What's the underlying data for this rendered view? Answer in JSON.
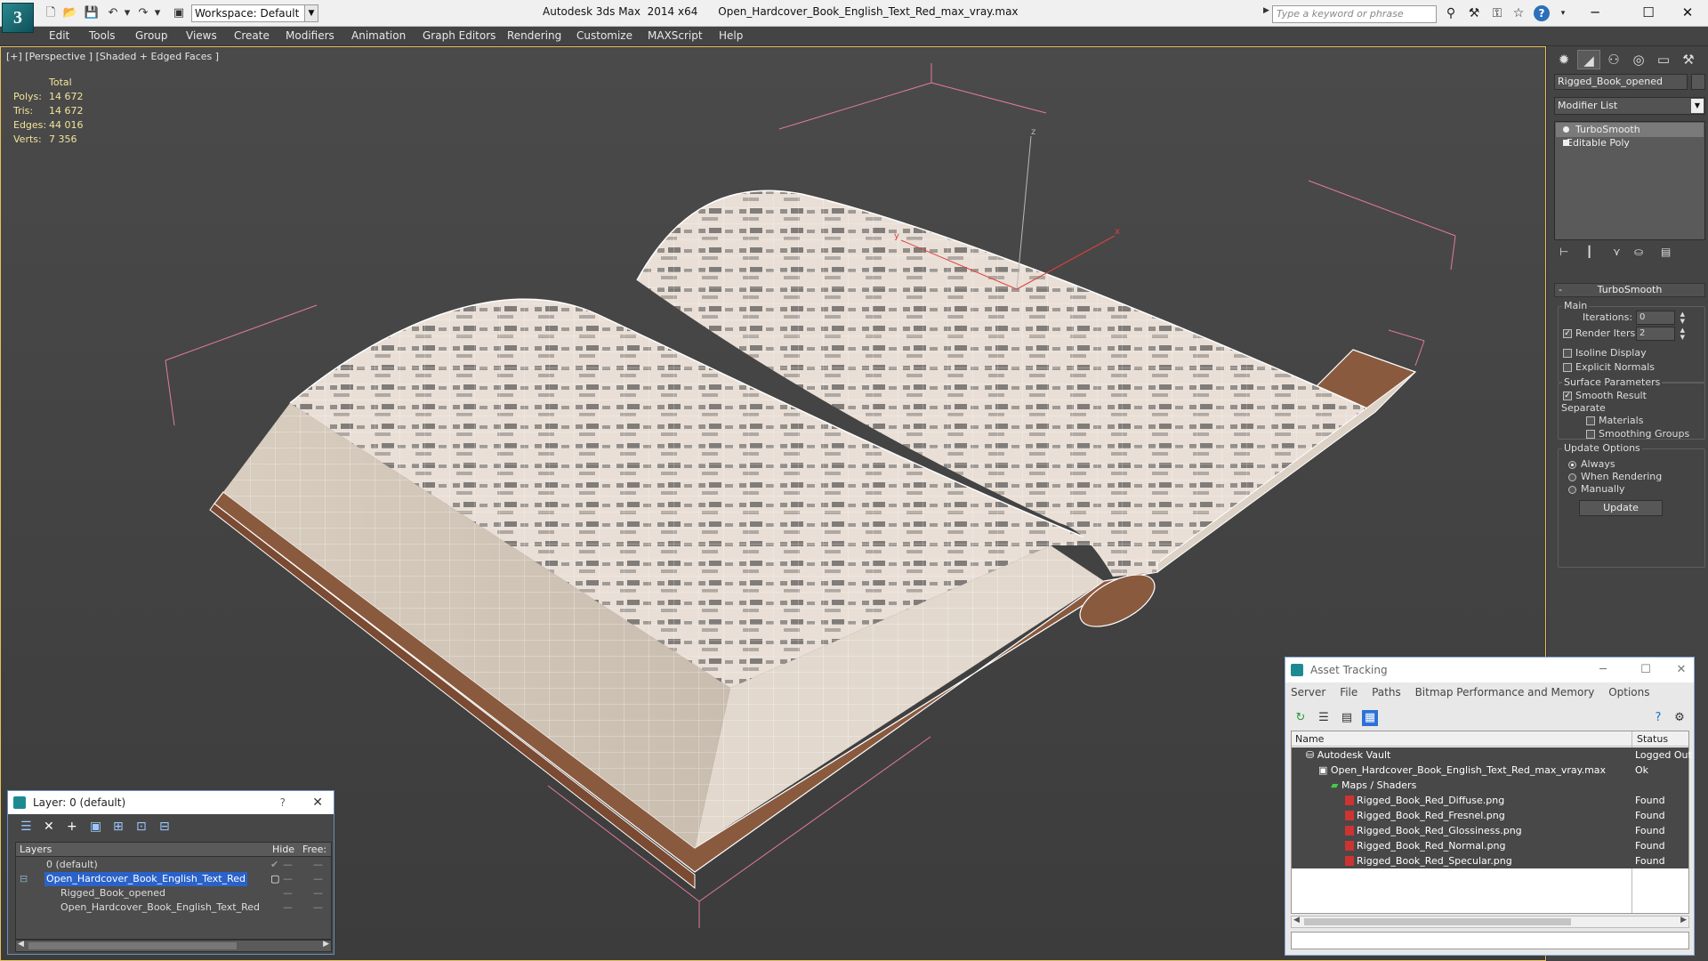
{
  "titlebar": {
    "app_logo": "3",
    "workspace": "Workspace: Default",
    "app_title": "Autodesk 3ds Max  2014 x64",
    "file_name": "Open_Hardcover_Book_English_Text_Red_max_vray.max",
    "search_placeholder": "Type a keyword or phrase",
    "help": "?"
  },
  "menu": {
    "items": [
      "Edit",
      "Tools",
      "Group",
      "Views",
      "Create",
      "Modifiers",
      "Animation",
      "Graph Editors",
      "Rendering",
      "Customize",
      "MAXScript",
      "Help"
    ]
  },
  "viewport": {
    "label": "[+] [Perspective ] [Shaded + Edged Faces ]",
    "stats": {
      "header": "Total",
      "polys_label": "Polys:",
      "polys": "14 672",
      "tris_label": "Tris:",
      "tris": "14 672",
      "edges_label": "Edges:",
      "edges": "44 016",
      "verts_label": "Verts:",
      "verts": "7 356"
    },
    "gizmo_z": "z",
    "gizmo_x": "x",
    "gizmo_y": "y"
  },
  "command_panel": {
    "object_name": "Rigged_Book_opened",
    "modifier_list": "Modifier List",
    "stack": [
      "TurboSmooth",
      "Editable Poly"
    ],
    "rollout_title": "TurboSmooth",
    "main_group": "Main",
    "iterations_label": "Iterations:",
    "iterations": "0",
    "render_iters_label": "Render Iters:",
    "render_iters": "2",
    "isoline_label": "Isoline Display",
    "explicit_normals_label": "Explicit Normals",
    "surface_group": "Surface Parameters",
    "smooth_result_label": "Smooth Result",
    "separate_label": "Separate",
    "materials_label": "Materials",
    "smoothing_groups_label": "Smoothing Groups",
    "update_group": "Update Options",
    "always_label": "Always",
    "when_rendering_label": "When Rendering",
    "manually_label": "Manually",
    "update_button": "Update"
  },
  "layer_dialog": {
    "title": "Layer: 0 (default)",
    "help": "?",
    "col_layers": "Layers",
    "col_hide": "Hide",
    "col_freeze": "Free:",
    "rows": [
      {
        "name": "0 (default)"
      },
      {
        "name": "Open_Hardcover_Book_English_Text_Red"
      },
      {
        "name": "Rigged_Book_opened"
      },
      {
        "name": "Open_Hardcover_Book_English_Text_Red"
      }
    ]
  },
  "asset_tracking": {
    "title": "Asset Tracking",
    "menu": [
      "Server",
      "File",
      "Paths",
      "Bitmap Performance and Memory",
      "Options"
    ],
    "col_name": "Name",
    "col_status": "Status",
    "rows": [
      {
        "name": "Autodesk Vault",
        "status": "Logged Out"
      },
      {
        "name": "Open_Hardcover_Book_English_Text_Red_max_vray.max",
        "status": "Ok"
      },
      {
        "name": "Maps / Shaders",
        "status": ""
      },
      {
        "name": "Rigged_Book_Red_Diffuse.png",
        "status": "Found"
      },
      {
        "name": "Rigged_Book_Red_Fresnel.png",
        "status": "Found"
      },
      {
        "name": "Rigged_Book_Red_Glossiness.png",
        "status": "Found"
      },
      {
        "name": "Rigged_Book_Red_Normal.png",
        "status": "Found"
      },
      {
        "name": "Rigged_Book_Red_Specular.png",
        "status": "Found"
      }
    ]
  },
  "colors": {
    "viewport_border": "#e6c15c",
    "stats_text": "#f2e49a",
    "selection": "#2a62c9",
    "bounding_box": "#e07aa0"
  }
}
